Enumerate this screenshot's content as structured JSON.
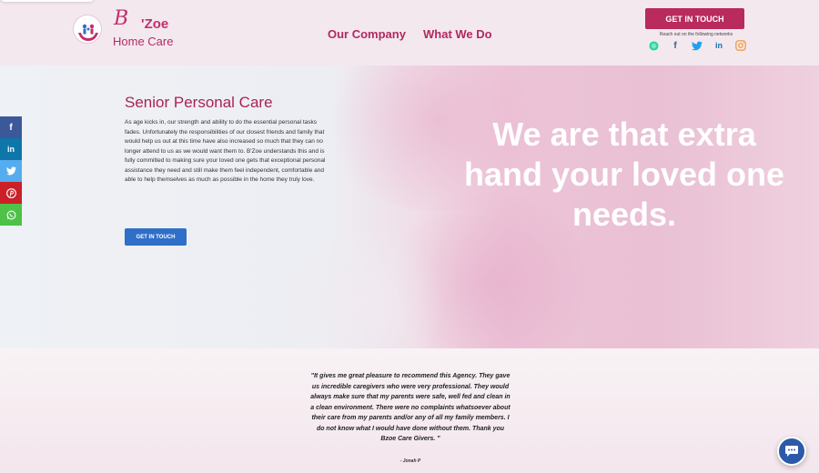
{
  "header": {
    "brand": {
      "initial": "B",
      "name": "'Zoe",
      "subtitle": "Home Care"
    },
    "nav": [
      {
        "label": "Our Company"
      },
      {
        "label": "What We Do"
      }
    ],
    "cta_label": "GET IN TOUCH",
    "reach_text": "Reach out on the following networks",
    "social": [
      {
        "icon": "whatsapp-icon",
        "glyph": "●",
        "color": "#2bd4a4"
      },
      {
        "icon": "facebook-icon",
        "glyph": "f",
        "color": "#3b5998"
      },
      {
        "icon": "twitter-icon",
        "glyph": "🐦",
        "color": "#1da1f2"
      },
      {
        "icon": "linkedin-icon",
        "glyph": "in",
        "color": "#0e76a8"
      },
      {
        "icon": "instagram-icon",
        "glyph": "◎",
        "color": "#f0a04b"
      }
    ]
  },
  "share_rail": [
    {
      "icon": "facebook-icon",
      "glyph": "f",
      "color": "#3b5998"
    },
    {
      "icon": "linkedin-icon",
      "glyph": "in",
      "color": "#0e76a8"
    },
    {
      "icon": "twitter-icon",
      "glyph": "🐦",
      "color": "#55acee"
    },
    {
      "icon": "pinterest-icon",
      "glyph": "P",
      "color": "#cb2027"
    },
    {
      "icon": "whatsapp-icon",
      "glyph": "✆",
      "color": "#4dc247"
    }
  ],
  "hero": {
    "title": "Senior Personal Care",
    "body": "As age kicks in, our strength and ability to do the essential personal tasks fades. Unfortunately the responsibilities of our closest friends and family that would help us out at this time have also increased so much that they can no longer attend to us as we would want them to. B'Zoe understands this and is fully committed to making sure your loved one gets that exceptional personal assistance they need and still make them feel independent, comfortable and able to help themselves as much as possible in the home they truly love.",
    "cta_label": "GET IN TOUCH",
    "tagline": "We are that extra hand your loved one needs."
  },
  "testimonial": {
    "quote": "\"It gives me great pleasure to recommend this Agency. They gave us incredible caregivers who were very professional. They would always make sure that my parents were safe, well fed and clean in a clean environment. There were no complaints whatsoever about their care from my parents and/or any of all my family members. I do not know what I would have done without them. Thank you Bzoe Care Givers. \"",
    "author": "- Jonah P"
  },
  "colors": {
    "brand": "#b92b5c",
    "nav": "#b1295f",
    "hero_cta": "#2f6fc8",
    "chat": "#2c5aa8"
  }
}
